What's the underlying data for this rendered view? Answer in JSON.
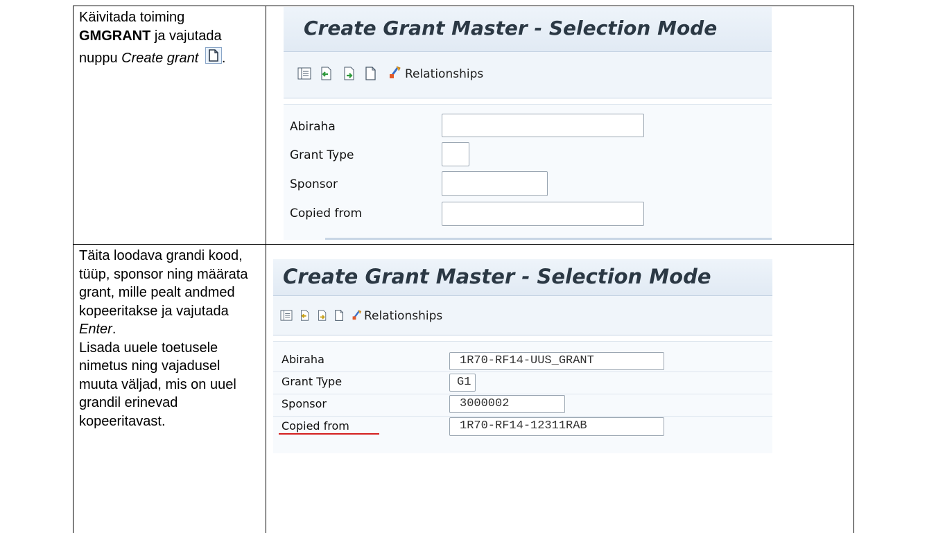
{
  "row1": {
    "line1": "Käivitada toiming",
    "code": "GMGRANT",
    "line2_suffix": " ja vajutada",
    "line3_prefix": "nuppu ",
    "line3_italic": "Create grant",
    "line3_suffix": ".",
    "screen": {
      "title": "Create Grant Master - Selection Mode",
      "toolbar_relationships": "Relationships",
      "fields": [
        {
          "label": "Abiraha",
          "value": ""
        },
        {
          "label": "Grant Type",
          "value": ""
        },
        {
          "label": "Sponsor",
          "value": ""
        },
        {
          "label": "Copied from",
          "value": ""
        }
      ]
    }
  },
  "row2": {
    "lines": [
      "Täita loodava grandi kood,",
      "tüüp, sponsor ning määrata",
      "grant, mille pealt andmed",
      "kopeeritakse ja vajutada"
    ],
    "enter_italic": "Enter",
    "enter_suffix": ".",
    "lines_after": [
      "Lisada uuele toetusele",
      "nimetus ning vajadusel",
      "muuta väljad, mis on uuel",
      "grandil erinevad",
      "kopeeritavast."
    ],
    "screen": {
      "title": "Create Grant Master - Selection Mode",
      "toolbar_relationships": "Relationships",
      "fields": [
        {
          "label": "Abiraha",
          "value": "1R70-RF14-UUS_GRANT"
        },
        {
          "label": "Grant Type",
          "value": "G1"
        },
        {
          "label": "Sponsor",
          "value": "3000002"
        },
        {
          "label": "Copied from",
          "value": "1R70-RF14-12311RAB"
        }
      ]
    }
  }
}
